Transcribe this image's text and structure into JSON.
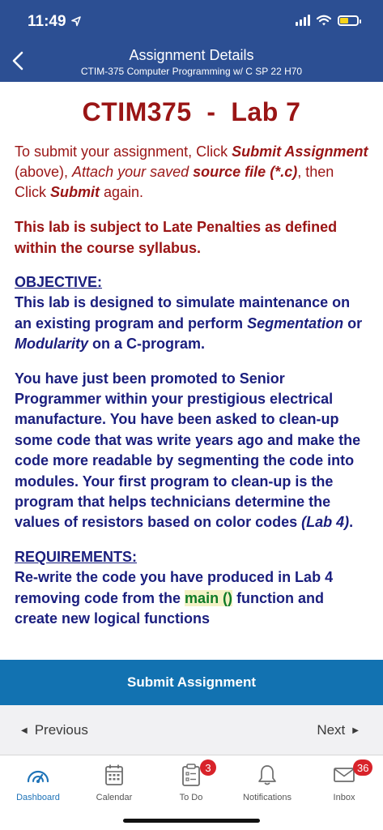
{
  "status_bar": {
    "time": "11:49"
  },
  "header": {
    "title": "Assignment Details",
    "subtitle": "CTIM-375 Computer Programming w/ C SP 22 H70"
  },
  "content": {
    "lab_title": "CTIM375  -  Lab 7",
    "instructions": {
      "t1": "To submit your assignment, Click ",
      "b1": "Submit Assignment",
      "t2": " (above), ",
      "i1": "Attach your saved",
      "bi1": "source file (*.c)",
      "t3": ", then Click ",
      "b2": "Submit",
      "t4": " again."
    },
    "late_notice": "This lab is subject to Late Penalties as defined within the course syllabus.",
    "objective_heading": "OBJECTIVE:",
    "objective": {
      "t1": "This lab is designed to simulate maintenance on an existing program and perform ",
      "i1": "Segmentation",
      "t2": " or ",
      "i2": "Modularity",
      "t3": " on a C-program."
    },
    "scenario": {
      "t1": "You have just been promoted to Senior Programmer within your prestigious electrical manufacture.  You have been asked to clean-up some code that was write years ago and make the code more readable by segmenting the code into modules.  Your first program to clean-up is the program that helps technicians determine the values of resistors based on color codes ",
      "i1": "(Lab 4)",
      "t2": "."
    },
    "requirements_heading": "REQUIREMENTS:",
    "requirements": {
      "t1": "Re-write the code you have produced in Lab 4 removing code from the ",
      "hl": "main ()",
      "t2": " function and create new logical functions"
    }
  },
  "submit_button": "Submit Assignment",
  "pager": {
    "previous": "Previous",
    "next": "Next"
  },
  "tabs": [
    {
      "label": "Dashboard",
      "icon": "dashboard-icon",
      "active": true
    },
    {
      "label": "Calendar",
      "icon": "calendar-icon"
    },
    {
      "label": "To Do",
      "icon": "todo-icon",
      "badge": "3"
    },
    {
      "label": "Notifications",
      "icon": "bell-icon"
    },
    {
      "label": "Inbox",
      "icon": "mail-icon",
      "badge": "36"
    }
  ],
  "colors": {
    "header": "#2c4f93",
    "accent_red": "#9a1515",
    "text_navy": "#1a1e7e",
    "submit_bar": "#1272b1",
    "badge": "#d8232a",
    "tab_active": "#1e73b8"
  }
}
